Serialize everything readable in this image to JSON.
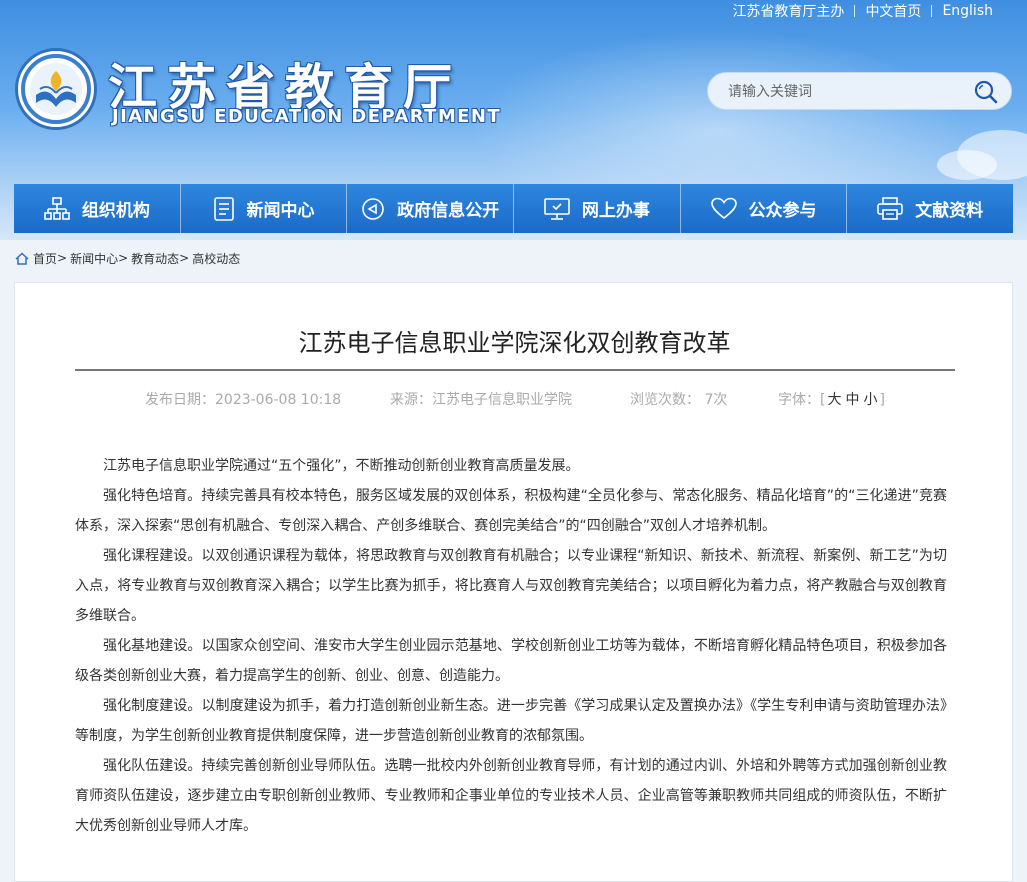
{
  "header": {
    "top_links": [
      "江苏省教育厅主办",
      "中文首页",
      "English"
    ],
    "logo_cn": "江苏省教育厅",
    "logo_en": "JIANGSU EDUCATION DEPARTMENT",
    "search_placeholder": "请输入关键词"
  },
  "nav": {
    "items": [
      {
        "label": "组织机构",
        "icon": "org-chart-icon"
      },
      {
        "label": "新闻中心",
        "icon": "document-icon"
      },
      {
        "label": "政府信息公开",
        "icon": "announcement-icon"
      },
      {
        "label": "网上办事",
        "icon": "monitor-icon"
      },
      {
        "label": "公众参与",
        "icon": "heart-icon"
      },
      {
        "label": "文献资料",
        "icon": "printer-icon"
      }
    ]
  },
  "breadcrumb": {
    "items": [
      "首页",
      "新闻中心",
      "教育动态",
      "高校动态"
    ],
    "separator": ">"
  },
  "article": {
    "title": "江苏电子信息职业学院深化双创教育改革",
    "meta": {
      "date": "发布日期：2023-06-08 10:18",
      "source": "来源：江苏电子信息职业学院",
      "views": "浏览次数：  7次",
      "font_label": "字体：",
      "bracket_open": "[",
      "sizes": [
        "大",
        "中",
        "小"
      ],
      "bracket_close": "]"
    },
    "paragraphs": [
      "江苏电子信息职业学院通过“五个强化”，不断推动创新创业教育高质量发展。",
      "强化特色培育。持续完善具有校本特色，服务区域发展的双创体系，积极构建“全员化参与、常态化服务、精品化培育”的“三化递进”竞赛体系，深入探索“思创有机融合、专创深入耦合、产创多维联合、赛创完美结合”的“四创融合”双创人才培养机制。",
      "强化课程建设。以双创通识课程为载体，将思政教育与双创教育有机融合；以专业课程“新知识、新技术、新流程、新案例、新工艺”为切入点，将专业教育与双创教育深入耦合；以学生比赛为抓手，将比赛育人与双创教育完美结合；以项目孵化为着力点，将产教融合与双创教育多维联合。",
      "强化基地建设。以国家众创空间、淮安市大学生创业园示范基地、学校创新创业工坊等为载体，不断培育孵化精品特色项目，积极参加各级各类创新创业大赛，着力提高学生的创新、创业、创意、创造能力。",
      "强化制度建设。以制度建设为抓手，着力打造创新创业新生态。进一步完善《学习成果认定及置换办法》《学生专利申请与资助管理办法》等制度，为学生创新创业教育提供制度保障，进一步营造创新创业教育的浓郁氛围。",
      "强化队伍建设。持续完善创新创业导师队伍。选聘一批校内外创新创业教育导师，有计划的通过内训、外培和外聘等方式加强创新创业教育师资队伍建设，逐步建立由专职创新创业教师、专业教师和企事业单位的专业技术人员、企业高管等兼职教师共同组成的师资队伍，不断扩大优秀创新创业导师人才库。"
    ]
  },
  "colors": {
    "nav_bg": "#1a6bc8",
    "header_sky": "#3f8ee0"
  }
}
